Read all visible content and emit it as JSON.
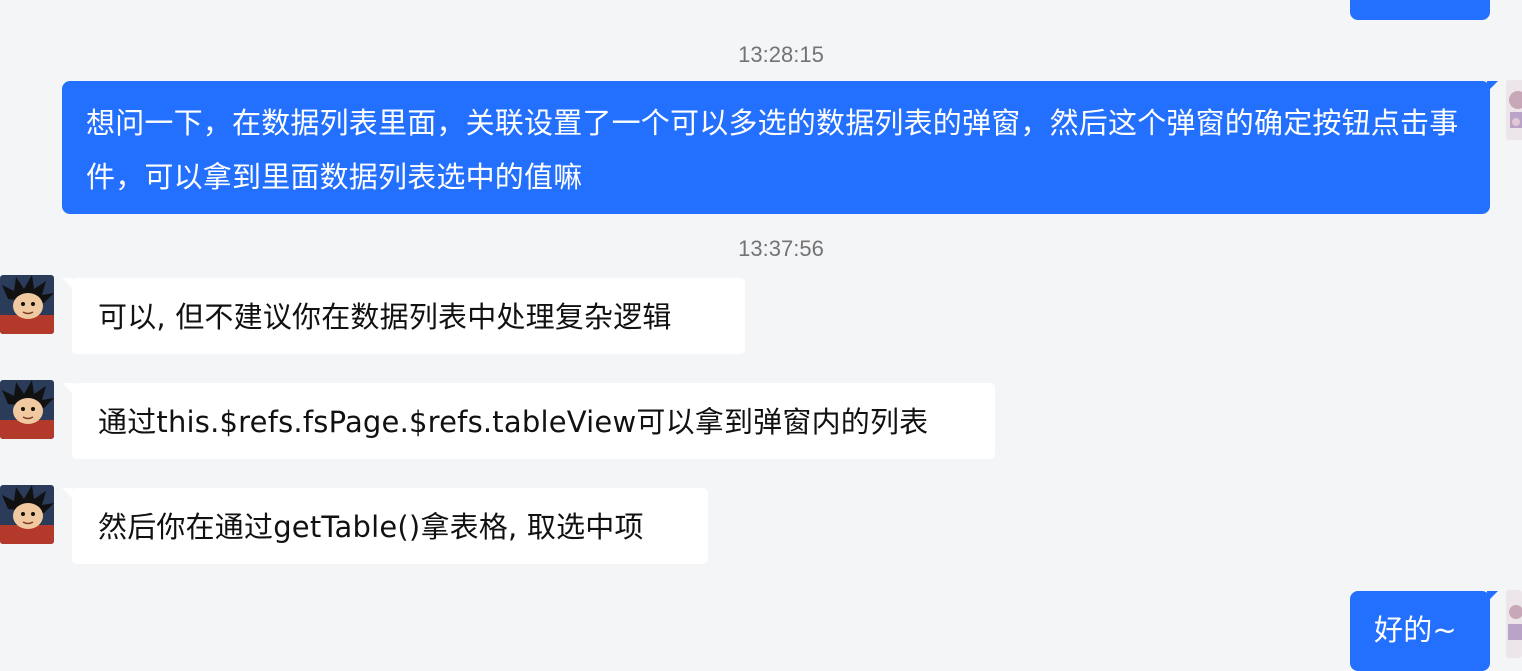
{
  "conversation": {
    "timestamps": [
      "13:28:15",
      "13:37:56"
    ],
    "messages": [
      {
        "sender": "me",
        "text": "想问一下，在数据列表里面，关联设置了一个可以多选的数据列表的弹窗，然后这个弹窗的确定按钮点击事件，可以拿到里面数据列表选中的值嘛"
      },
      {
        "sender": "other",
        "text": "可以, 但不建议你在数据列表中处理复杂逻辑"
      },
      {
        "sender": "other",
        "text": "通过this.$refs.fsPage.$refs.tableView可以拿到弹窗内的列表"
      },
      {
        "sender": "other",
        "text": "然后你在通过getTable()拿表格, 取选中项"
      },
      {
        "sender": "me",
        "text": "好的~"
      }
    ]
  },
  "colors": {
    "background": "#f4f5f7",
    "outgoing_bubble": "#236ffe",
    "incoming_bubble": "#ffffff",
    "timestamp_text": "#737373"
  },
  "icons": {
    "self_avatar": "user-avatar-icon",
    "contact_avatar": "cartoon-boy-avatar-icon"
  }
}
